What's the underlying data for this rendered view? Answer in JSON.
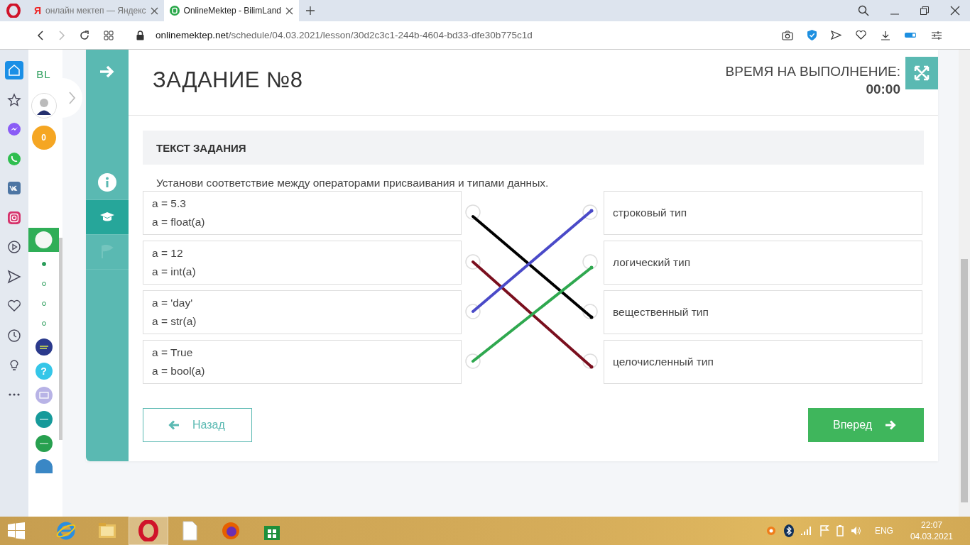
{
  "browser": {
    "tabs": [
      {
        "title": "онлайн мектеп — Яндекс",
        "kind": "yandex",
        "favicon_text": "Я",
        "selected": false
      },
      {
        "title": "OnlineMektep - BilimLand",
        "kind": "site",
        "selected": true
      }
    ],
    "address": {
      "host": "onlinemektep.net",
      "path": "/schedule/04.03.2021/lesson/30d2c3c1-244b-4604-bd33-dfe30b775c1d"
    }
  },
  "opera_sidebar": {
    "items": [
      {
        "kind": "home",
        "selected": true
      },
      {
        "kind": "star",
        "selected": false
      },
      {
        "kind": "messenger",
        "selected": false
      },
      {
        "kind": "whatsapp",
        "selected": false
      },
      {
        "kind": "vk",
        "selected": false
      },
      {
        "kind": "instagram",
        "selected": false
      },
      {
        "kind": "player",
        "selected": false
      },
      {
        "kind": "send",
        "selected": false
      },
      {
        "kind": "heart",
        "selected": false
      },
      {
        "kind": "clock",
        "selected": false
      },
      {
        "kind": "bulb",
        "selected": false
      },
      {
        "kind": "more",
        "selected": false
      }
    ]
  },
  "site_sidebar": {
    "logo": "BL",
    "coins": "0",
    "help": "?",
    "pages": [
      {
        "selected": true
      },
      {
        "selected": false
      },
      {
        "selected": false
      },
      {
        "selected": false
      }
    ]
  },
  "side_tabs": [
    {
      "kind": "info",
      "selected": false,
      "disabled": false
    },
    {
      "kind": "cap",
      "selected": true,
      "disabled": false
    },
    {
      "kind": "flag",
      "selected": false,
      "disabled": true
    }
  ],
  "task": {
    "title": "ЗАДАНИЕ №8",
    "timer_label": "ВРЕМЯ НА ВЫПОЛНЕНИЕ:",
    "timer": "00:00",
    "heading": "ТЕКСТ ЗАДАНИЯ",
    "instruction": "Установи соответствие между операторами присваивания и типами данных.",
    "left_items": [
      {
        "lines": [
          "a = 5.3",
          "a = float(a)"
        ],
        "color": "#000000"
      },
      {
        "lines": [
          "a = 12",
          "a = int(a)"
        ],
        "color": "#7a0f1e"
      },
      {
        "lines": [
          "a = 'day'",
          "a = str(a)"
        ],
        "color": "#4a4ac8"
      },
      {
        "lines": [
          "a = True",
          "a = bool(a)"
        ],
        "color": "#2fa84f"
      }
    ],
    "right_items": [
      {
        "text": "строковый тип",
        "color": "#4a4ac8"
      },
      {
        "text": "логический тип",
        "color": "#2fa84f"
      },
      {
        "text": "вещественный тип",
        "color": "#000000"
      },
      {
        "text": "целочисленный тип",
        "color": "#7a0f1e"
      }
    ],
    "back_button": "Назад",
    "next_button": "Вперед"
  },
  "taskbar": {
    "apps": [
      {
        "kind": "ie",
        "selected": false
      },
      {
        "kind": "explorer",
        "selected": false
      },
      {
        "kind": "opera",
        "selected": true
      },
      {
        "kind": "file",
        "selected": false
      },
      {
        "kind": "firefox",
        "selected": false
      },
      {
        "kind": "store",
        "selected": false
      }
    ],
    "language": "ENG",
    "time": "22:07",
    "date": "04.03.2021"
  }
}
